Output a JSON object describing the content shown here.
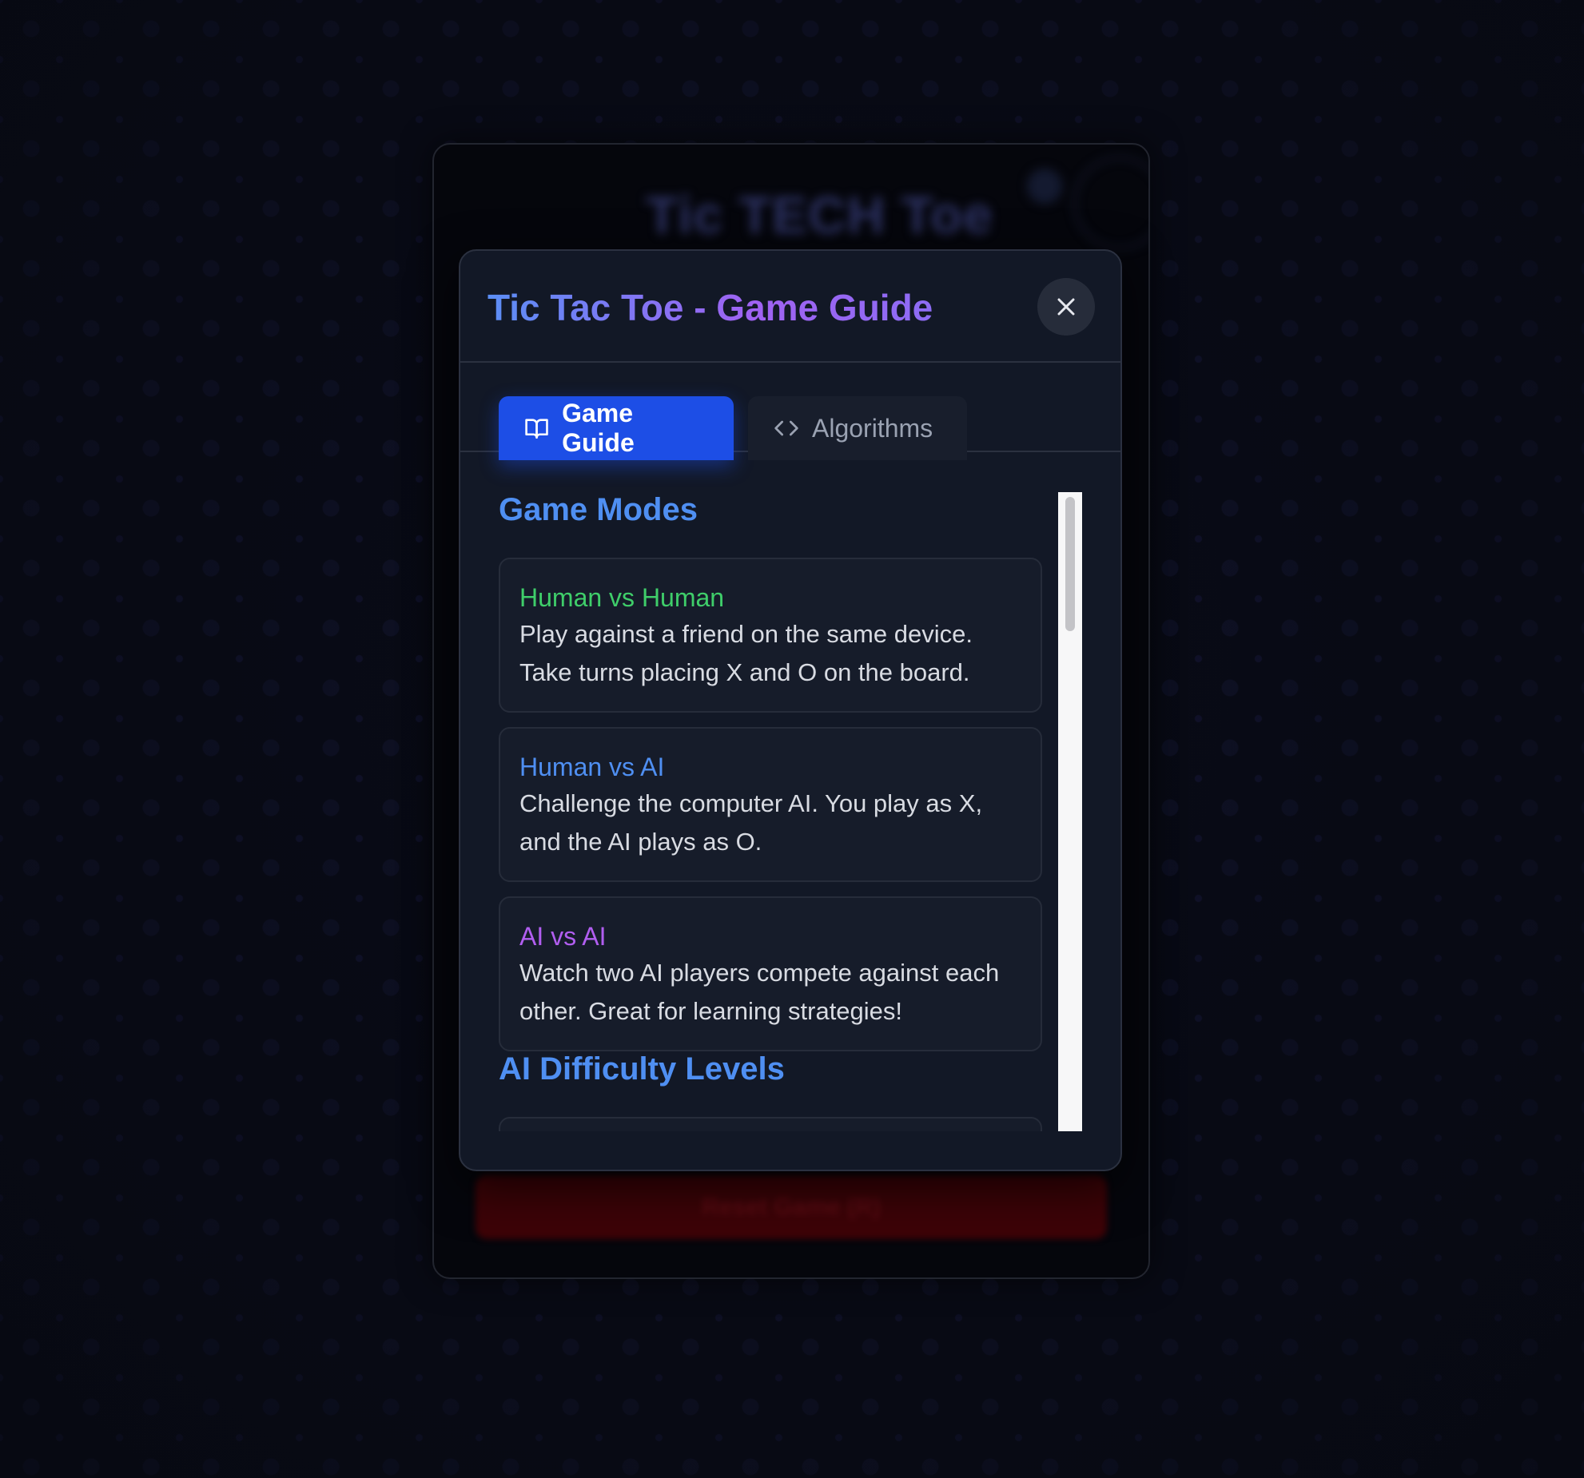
{
  "background_app": {
    "title": "Tic TECH Toe",
    "reset_label": "Reset Game (R)"
  },
  "modal": {
    "title": "Tic Tac Toe - Game Guide",
    "close_icon": "close-icon",
    "tabs": [
      {
        "label": "Game Guide",
        "icon": "book-open-icon",
        "active": true
      },
      {
        "label": "Algorithms",
        "icon": "code-icon",
        "active": false
      }
    ],
    "sections": [
      {
        "title": "Game Modes",
        "cards": [
          {
            "title": "Human vs Human",
            "color": "#3fce6a",
            "text": "Play against a friend on the same device. Take turns placing X and O on the board."
          },
          {
            "title": "Human vs AI",
            "color": "#4f8ff2",
            "text": "Challenge the computer AI. You play as X, and the AI plays as O."
          },
          {
            "title": "AI vs AI",
            "color": "#b15ef0",
            "text": "Watch two AI players compete against each other. Great for learning strategies!"
          }
        ]
      },
      {
        "title": "AI Difficulty Levels",
        "cards": []
      }
    ]
  },
  "colors": {
    "accent_blue": "#1d4ee6",
    "heading_blue": "#4f8ff2",
    "modal_bg": "#121826"
  }
}
